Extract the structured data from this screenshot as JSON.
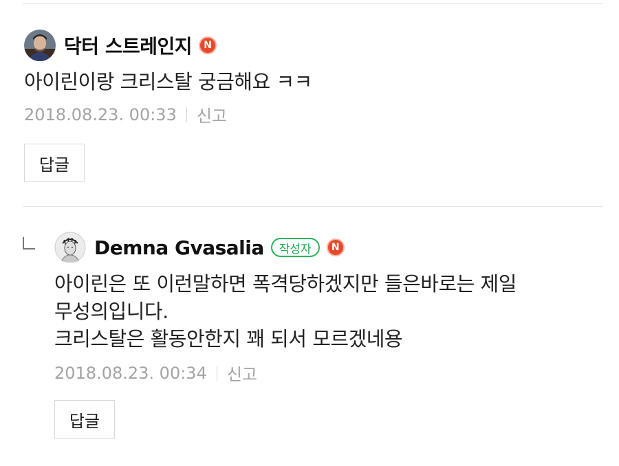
{
  "comments": [
    {
      "author": "닥터 스트레인지",
      "naver_badge": "N",
      "body_lines": [
        "아이린이랑 크리스탈 궁금해요 ㅋㅋ"
      ],
      "date": "2018.08.23. 00:33",
      "report_label": "신고",
      "reply_label": "답글",
      "avatar_icon": "doctor-strange-avatar-icon"
    },
    {
      "author": "Demna Gvasalia",
      "writer_tag": "작성자",
      "naver_badge": "N",
      "body_lines": [
        "아이린은 또 이런말하면 폭격당하겠지만 들은바로는 제일",
        "무성의입니다.",
        "크리스탈은 활동안한지 꽤 되서 모르겠네용"
      ],
      "date": "2018.08.23. 00:34",
      "report_label": "신고",
      "reply_label": "답글",
      "avatar_icon": "sketch-avatar-icon",
      "reply_indicator_icon": "reply-arrow-icon"
    }
  ],
  "colors": {
    "naver_badge": "#e8492b",
    "writer_tag": "#27b55a",
    "meta_text": "#a3a3a3",
    "divider": "#e5e5e5"
  }
}
